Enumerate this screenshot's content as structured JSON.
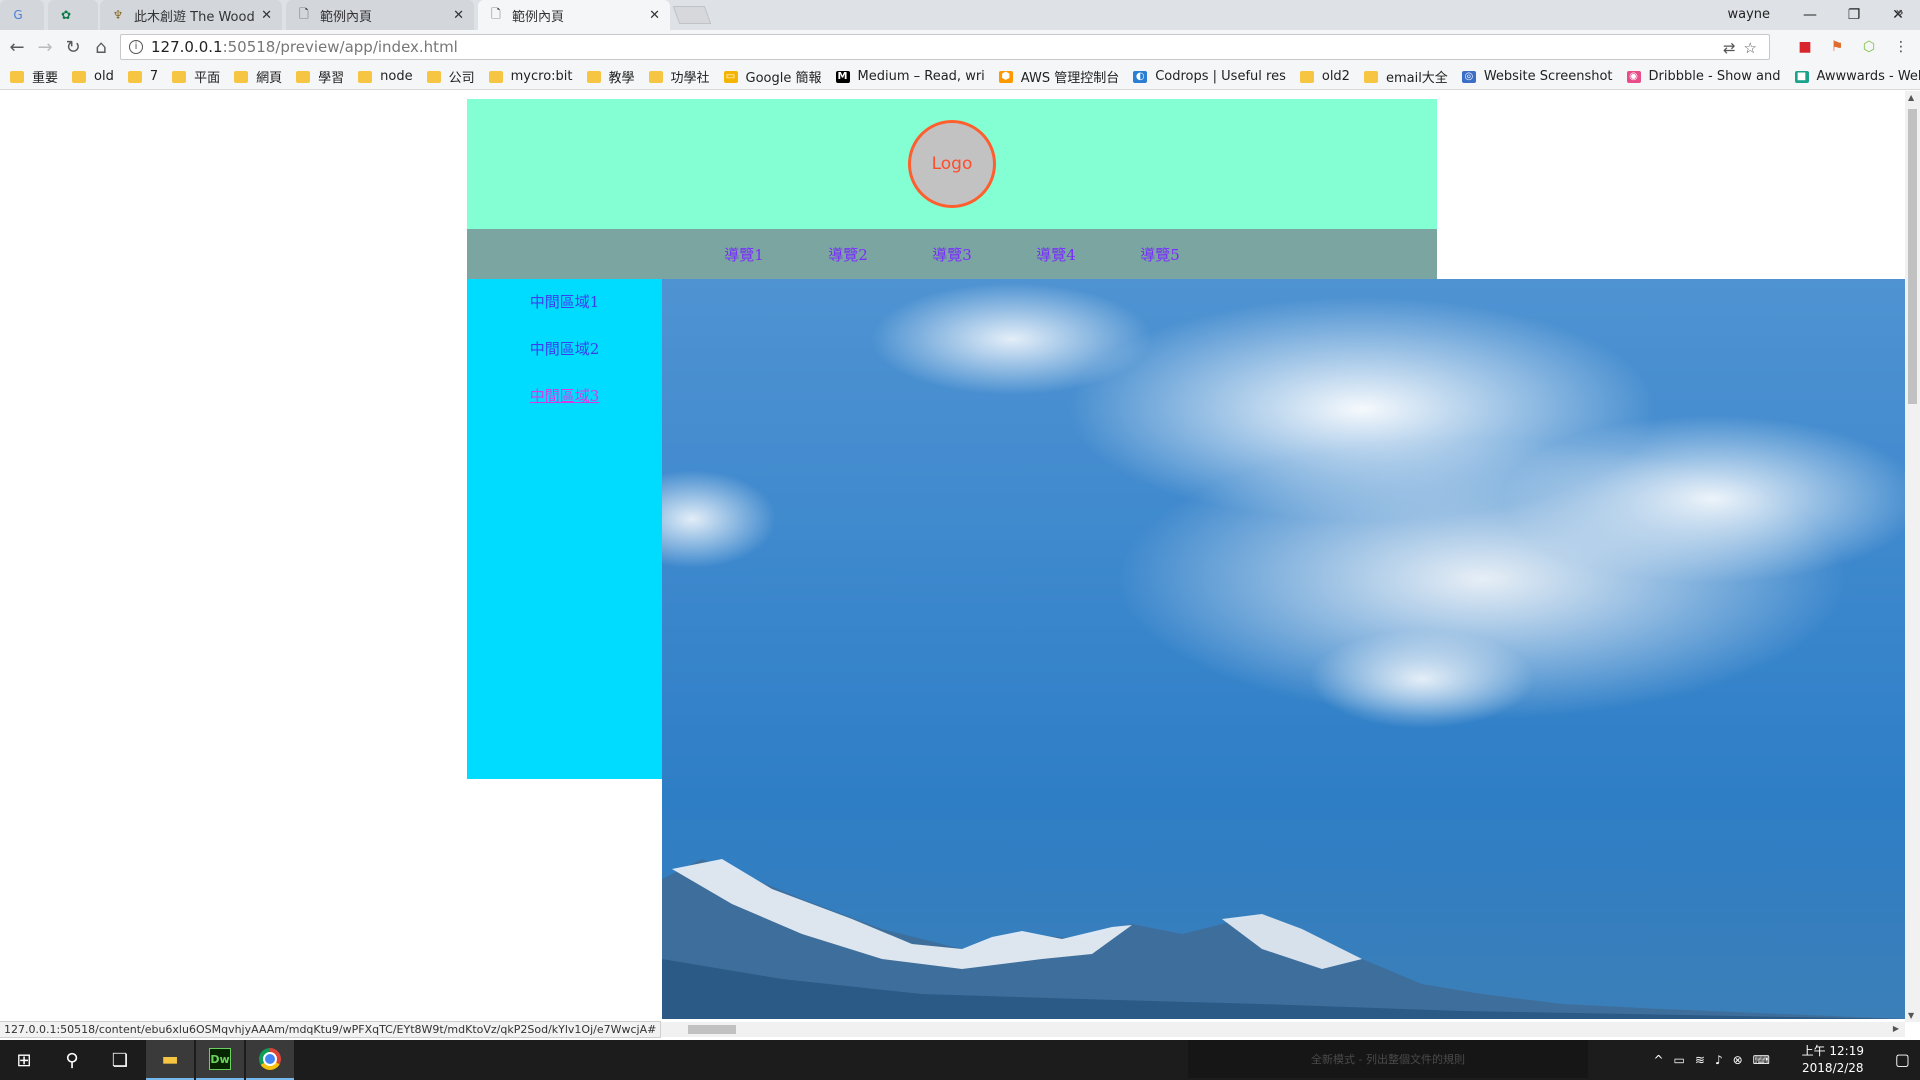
{
  "browser": {
    "tabs": [
      {
        "title": "",
        "icon": "translate-icon"
      },
      {
        "title": "",
        "icon": "starbucks-icon"
      },
      {
        "title": "此木創遊 The Wood Ga",
        "icon": "wood-game-icon"
      },
      {
        "title": "範例內頁",
        "icon": "page-icon"
      },
      {
        "title": "範例內頁",
        "icon": "page-icon"
      }
    ],
    "active_tab": 4,
    "profile_name": "wayne",
    "url_host": "127.0.0.1",
    "url_path": ":50518/preview/app/index.html",
    "bookmarks": [
      {
        "label": "重要",
        "icon": "folder-icon"
      },
      {
        "label": "old",
        "icon": "folder-icon"
      },
      {
        "label": "7",
        "icon": "folder-icon"
      },
      {
        "label": "平面",
        "icon": "folder-icon"
      },
      {
        "label": "網頁",
        "icon": "folder-icon"
      },
      {
        "label": "學習",
        "icon": "folder-icon"
      },
      {
        "label": "node",
        "icon": "folder-icon"
      },
      {
        "label": "公司",
        "icon": "folder-icon"
      },
      {
        "label": "mycro:bit",
        "icon": "folder-icon"
      },
      {
        "label": "教學",
        "icon": "folder-icon"
      },
      {
        "label": "功學社",
        "icon": "folder-icon"
      },
      {
        "label": "Google 簡報",
        "icon": "google-slides-icon"
      },
      {
        "label": "Medium – Read, wri",
        "icon": "medium-icon"
      },
      {
        "label": "AWS 管理控制台",
        "icon": "aws-icon"
      },
      {
        "label": "Codrops | Useful res",
        "icon": "codrops-icon"
      },
      {
        "label": "old2",
        "icon": "folder-icon"
      },
      {
        "label": "email大全",
        "icon": "folder-icon"
      },
      {
        "label": "Website Screenshot",
        "icon": "globe-icon"
      },
      {
        "label": "Dribbble - Show and",
        "icon": "dribbble-icon"
      },
      {
        "label": "Awwwards - Websit",
        "icon": "awwwards-icon"
      }
    ],
    "status_url": "127.0.0.1:50518/content/ebu6xlu6OSMqvhjyAAAm/mdqKtu9/wPFXqTC/EYt8W9t/mdKtoVz/qkP2Sod/kYlv1Oj/e7WwcjA#"
  },
  "page": {
    "logo_text": "Logo",
    "nav": [
      "導覽1",
      "導覽2",
      "導覽3",
      "導覽4",
      "導覽5"
    ],
    "sidebar": [
      "中間區域1",
      "中間區域2",
      "中間區域3"
    ],
    "sidebar_active_index": 2,
    "colors": {
      "header_bg": "#84ffd4",
      "nav_bg": "#7aa5a0",
      "sidebar_bg": "#00dcff",
      "logo_border": "#ff5e2e",
      "nav_link": "#7b2cff"
    }
  },
  "taskbar": {
    "ime_hint": "全新模式 - 列出整個文件的規則",
    "time": "上午 12:19",
    "date": "2018/2/28"
  }
}
